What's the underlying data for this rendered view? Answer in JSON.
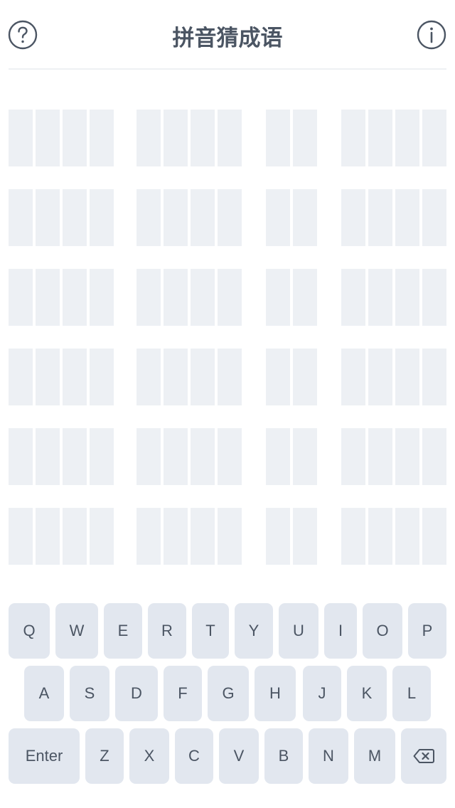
{
  "header": {
    "title": "拼音猜成语",
    "help_icon": "question-circle-icon",
    "info_icon": "info-circle-icon"
  },
  "board": {
    "rows": 6,
    "groups_letter_slots": [
      4,
      4,
      2,
      4
    ],
    "guesses": [
      [
        "",
        "",
        "",
        ""
      ],
      [
        "",
        "",
        "",
        ""
      ],
      [
        "",
        "",
        "",
        ""
      ],
      [
        "",
        "",
        "",
        ""
      ],
      [
        "",
        "",
        "",
        ""
      ],
      [
        "",
        "",
        "",
        ""
      ]
    ],
    "empty_cell_color": "#edf0f4"
  },
  "keyboard": {
    "row1": [
      "Q",
      "W",
      "E",
      "R",
      "T",
      "Y",
      "U",
      "I",
      "O",
      "P"
    ],
    "row2": [
      "A",
      "S",
      "D",
      "F",
      "G",
      "H",
      "J",
      "K",
      "L"
    ],
    "row3": [
      "Enter",
      "Z",
      "X",
      "C",
      "V",
      "B",
      "N",
      "M"
    ],
    "backspace_icon": "backspace-icon",
    "key_color": "#e2e7ef",
    "text_color": "#4b5563"
  }
}
